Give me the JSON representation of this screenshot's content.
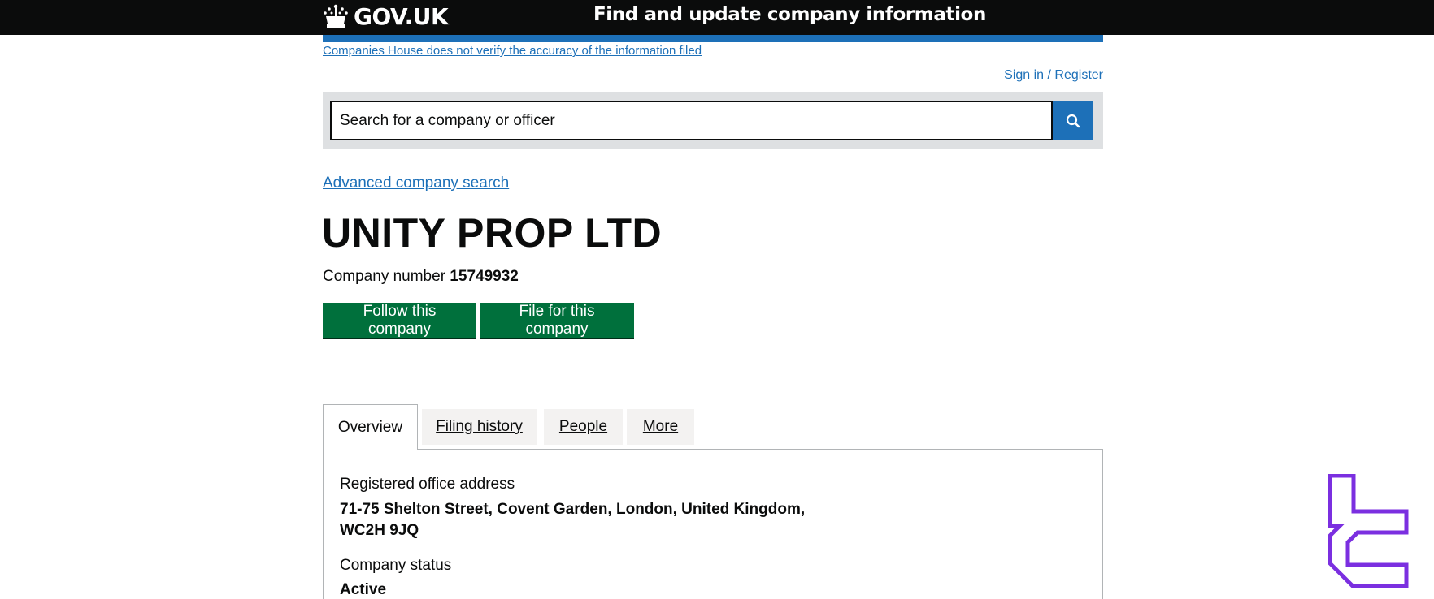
{
  "header": {
    "logo_text": "GOV.UK",
    "service_name": "Find and update company information"
  },
  "notice": {
    "disclaimer": "Companies House does not verify the accuracy of the information filed",
    "sign_in": "Sign in / Register"
  },
  "search": {
    "placeholder": "Search for a company or officer",
    "button_icon": "search-icon"
  },
  "advanced_search_link": "Advanced company search",
  "company": {
    "name": "UNITY PROP LTD",
    "number_label": "Company number",
    "number": "15749932"
  },
  "actions": {
    "follow": "Follow this company",
    "file": "File for this company"
  },
  "tabs": [
    {
      "label": "Overview",
      "active": true
    },
    {
      "label": "Filing history",
      "active": false
    },
    {
      "label": "People",
      "active": false
    },
    {
      "label": "More",
      "active": false
    }
  ],
  "overview": {
    "address_label": "Registered office address",
    "address_line1": "71-75 Shelton Street, Covent Garden, London, United Kingdom,",
    "address_line2": "WC2H 9JQ",
    "status_label": "Company status",
    "status_value": "Active"
  },
  "colors": {
    "header_bg": "#0b0c0c",
    "link": "#1d70b8",
    "button_green": "#00703c",
    "watermark_purple": "#7b2fe0"
  }
}
